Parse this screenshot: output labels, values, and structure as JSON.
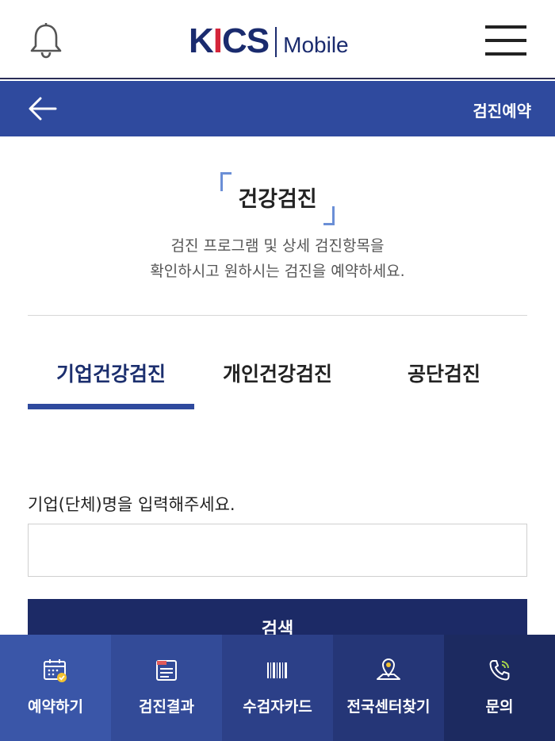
{
  "header": {
    "logo_brand_a": "K",
    "logo_brand_b": "I",
    "logo_brand_c": "CS",
    "logo_sub": "Mobile"
  },
  "subheader": {
    "title": "검진예약"
  },
  "section": {
    "heading": "건강검진",
    "desc_line1": "검진 프로그램 및 상세 검진항목을",
    "desc_line2": "확인하시고 원하시는 검진을 예약하세요."
  },
  "tabs": [
    {
      "label": "기업건강검진",
      "active": true
    },
    {
      "label": "개인건강검진",
      "active": false
    },
    {
      "label": "공단검진",
      "active": false
    }
  ],
  "form": {
    "label": "기업(단체)명을 입력해주세요.",
    "input_value": "",
    "search_label": "검색"
  },
  "bottom_nav": [
    {
      "label": "예약하기",
      "icon": "calendar-check-icon",
      "color": "#3a56a8"
    },
    {
      "label": "검진결과",
      "icon": "document-icon",
      "color": "#334b98"
    },
    {
      "label": "수검자카드",
      "icon": "barcode-icon",
      "color": "#2c4088"
    },
    {
      "label": "전국센터찾기",
      "icon": "map-pin-icon",
      "color": "#253677"
    },
    {
      "label": "문의",
      "icon": "phone-icon",
      "color": "#1c2a60"
    }
  ],
  "colors": {
    "primary": "#2f4a9e",
    "dark_navy": "#1c2a66",
    "logo_navy": "#1a2b6e",
    "logo_red": "#d5253a",
    "accent_bracket": "#6b8fd6"
  }
}
